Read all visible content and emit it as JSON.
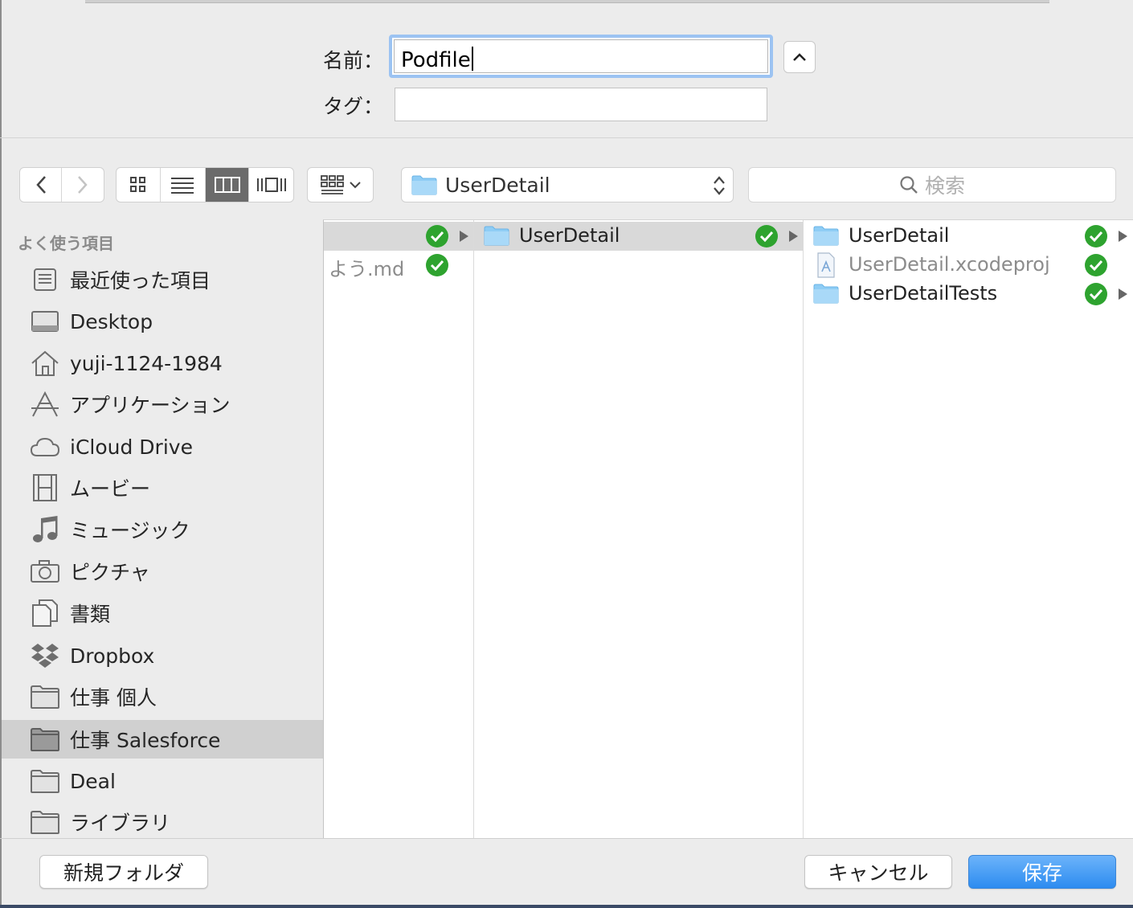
{
  "form": {
    "name_label": "名前：",
    "name_value": "Podfile",
    "tag_label": "タグ：",
    "tag_value": ""
  },
  "toolbar": {
    "current_folder": "UserDetail",
    "search_placeholder": "検索"
  },
  "sidebar": {
    "heading": "よく使う項目",
    "items": [
      {
        "label": "最近使った項目",
        "icon": "recents-icon"
      },
      {
        "label": "Desktop",
        "icon": "desktop-icon"
      },
      {
        "label": "yuji-1124-1984",
        "icon": "home-icon"
      },
      {
        "label": "アプリケーション",
        "icon": "applications-icon"
      },
      {
        "label": "iCloud Drive",
        "icon": "cloud-icon"
      },
      {
        "label": "ムービー",
        "icon": "movies-icon"
      },
      {
        "label": "ミュージック",
        "icon": "music-icon"
      },
      {
        "label": "ピクチャ",
        "icon": "camera-icon"
      },
      {
        "label": "書類",
        "icon": "documents-icon"
      },
      {
        "label": "Dropbox",
        "icon": "dropbox-icon"
      },
      {
        "label": "仕事 個人",
        "icon": "folder-icon"
      },
      {
        "label": "仕事 Salesforce",
        "icon": "folder-icon",
        "selected": true
      },
      {
        "label": "Deal",
        "icon": "folder-icon"
      },
      {
        "label": "ライブラリ",
        "icon": "folder-icon"
      }
    ]
  },
  "columns": {
    "col1": [
      {
        "name": "",
        "selected": true
      },
      {
        "name": "よう.md"
      }
    ],
    "col2": [
      {
        "name": "UserDetail",
        "selected": true
      }
    ],
    "col3": [
      {
        "name": "UserDetail",
        "kind": "folder"
      },
      {
        "name": "UserDetail.xcodeproj",
        "kind": "project"
      },
      {
        "name": "UserDetailTests",
        "kind": "folder"
      }
    ]
  },
  "buttons": {
    "new_folder": "新規フォルダ",
    "cancel": "キャンセル",
    "save": "保存"
  },
  "colors": {
    "accent": "#2d8cf0",
    "sync_ok": "#2ea32f",
    "selection": "#d0d0d0"
  }
}
